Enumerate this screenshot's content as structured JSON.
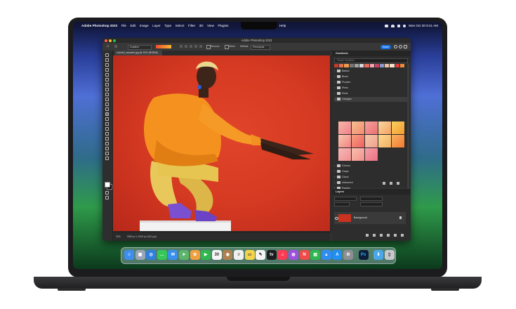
{
  "menubar": {
    "app_name": "Adobe Photoshop 2023",
    "items": [
      "File",
      "Edit",
      "Image",
      "Layer",
      "Type",
      "Select",
      "Filter",
      "3D",
      "View",
      "Plugins",
      "Window",
      "Help"
    ],
    "clock": "Mon Oct 30  9:41 AM"
  },
  "window": {
    "title": "Adobe Photoshop 2023"
  },
  "options_bar": {
    "tool_label": "Gradient",
    "reverse_label": "Reverse",
    "dither_label": "Dither",
    "method_label": "Method:",
    "method_value": "Perceptual",
    "share_label": "Share"
  },
  "document_tab": {
    "label": "colorful_sweater.jpg @ 33% (RGB/8)"
  },
  "status": {
    "zoom": "33%",
    "info": "3359 px x 2409 px (300 ppi)"
  },
  "gradients_panel": {
    "title": "Gradients",
    "search_placeholder": "Search Gradients",
    "folders": [
      "Basics",
      "Blues",
      "Purples",
      "Pinks",
      "Reds",
      "Oranges",
      "Greens",
      "Grays",
      "Cloud",
      "Iridescent",
      "Pastels"
    ],
    "active_folder": "Oranges",
    "preset_colors": [
      "#c63a2c",
      "#e4724a",
      "#f29b4a",
      "#777777",
      "#a3a3a3",
      "#d6d6d6",
      "#e86c5c",
      "#f3a0b0",
      "#d04060",
      "#8a9ad0",
      "#f2c0a0",
      "#f4e3d0",
      "#e03a3a",
      "#f08a3a"
    ],
    "orange_swatches": [
      {
        "c1": "#f8b8a8",
        "c2": "#f0808a"
      },
      {
        "c1": "#f6c090",
        "c2": "#f28a70"
      },
      {
        "c1": "#f4a0a0",
        "c2": "#ee7070"
      },
      {
        "c1": "#f8d8a0",
        "c2": "#f6a060"
      },
      {
        "c1": "#f9d060",
        "c2": "#f59a30"
      },
      {
        "c1": "#f8c8b0",
        "c2": "#f28080"
      },
      {
        "c1": "#f7a080",
        "c2": "#ee6060"
      },
      {
        "c1": "#f6c8a8",
        "c2": "#f0a090"
      },
      {
        "c1": "#fbd890",
        "c2": "#f3b060"
      },
      {
        "c1": "#f9b060",
        "c2": "#f07a30"
      },
      {
        "c1": "#f6b8b8",
        "c2": "#f09090"
      },
      {
        "c1": "#f8c0b0",
        "c2": "#f2908a"
      },
      {
        "c1": "#f3a0a8",
        "c2": "#ec7080"
      }
    ]
  },
  "layers_panel": {
    "title": "Layers",
    "layer_name": "Background"
  },
  "dock_apps": [
    {
      "name": "finder-icon",
      "color": "#3d8ef0",
      "glyph": "☺"
    },
    {
      "name": "launchpad-icon",
      "color": "#9aa6b8",
      "glyph": "▦"
    },
    {
      "name": "safari-icon",
      "color": "#2d7fe0",
      "glyph": "◎"
    },
    {
      "name": "messages-icon",
      "color": "#35c759",
      "glyph": "…"
    },
    {
      "name": "mail-icon",
      "color": "#3a8fef",
      "glyph": "✉"
    },
    {
      "name": "maps-icon",
      "color": "#5bb56a",
      "glyph": "➤"
    },
    {
      "name": "photos-icon",
      "color": "#f0a040",
      "glyph": "✿"
    },
    {
      "name": "facetime-icon",
      "color": "#2fb84f",
      "glyph": "▶"
    },
    {
      "name": "calendar-icon",
      "color": "#f5f5f5",
      "glyph": "30"
    },
    {
      "name": "contacts-icon",
      "color": "#b08050",
      "glyph": "◉"
    },
    {
      "name": "reminders-icon",
      "color": "#f0f0f0",
      "glyph": "≡"
    },
    {
      "name": "notes-icon",
      "color": "#f5d34a",
      "glyph": "▭"
    },
    {
      "name": "freeform-icon",
      "color": "#f4f4f4",
      "glyph": "✎"
    },
    {
      "name": "tv-icon",
      "color": "#1d1d1f",
      "glyph": "tv"
    },
    {
      "name": "music-icon",
      "color": "#fa3b55",
      "glyph": "♫"
    },
    {
      "name": "podcasts-icon",
      "color": "#a050e0",
      "glyph": "◍"
    },
    {
      "name": "news-icon",
      "color": "#f24a4a",
      "glyph": "N"
    },
    {
      "name": "numbers-icon",
      "color": "#2fb84f",
      "glyph": "▥"
    },
    {
      "name": "keynote-icon",
      "color": "#2f8ef0",
      "glyph": "▲"
    },
    {
      "name": "app-store-icon",
      "color": "#1f8ef5",
      "glyph": "A"
    },
    {
      "name": "system-settings-icon",
      "color": "#8e8e93",
      "glyph": "⚙"
    },
    {
      "name": "photoshop-icon",
      "color": "#0c1f38",
      "glyph": "Ps"
    },
    {
      "name": "downloads-folder-icon",
      "color": "#4aa8e8",
      "glyph": "⬇"
    },
    {
      "name": "trash-icon",
      "color": "#c7c7cc",
      "glyph": "▯"
    }
  ]
}
